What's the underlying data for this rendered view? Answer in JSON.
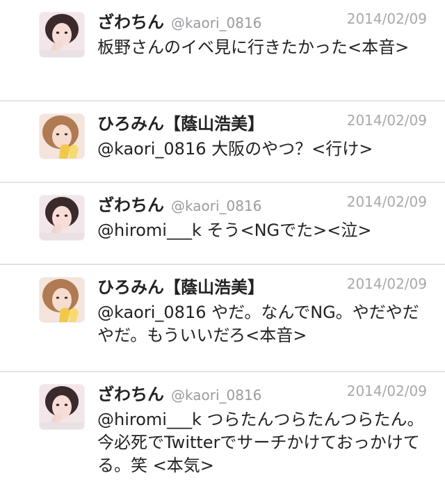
{
  "tweets": [
    {
      "name": "ざわちん",
      "handle": "@kaori_0816",
      "date": "2014/02/09",
      "text": "板野さんのイベ見に行きたかった<本音>",
      "avatar": "avatar-zawachin"
    },
    {
      "name": "ひろみん【蔭山浩美】",
      "handle": "",
      "date": "2014/02/09",
      "text": "@kaori_0816 大阪のやつ？<行け>",
      "avatar": "avatar-hiromin"
    },
    {
      "name": "ざわちん",
      "handle": "@kaori_0816",
      "date": "2014/02/09",
      "text": "@hiromi___k そう<NGでた><泣>",
      "avatar": "avatar-zawachin"
    },
    {
      "name": "ひろみん【蔭山浩美】",
      "handle": "",
      "date": "2014/02/09",
      "text": "@kaori_0816 やだ。なんでNG。やだやだやだ。もういいだろ<本音>",
      "avatar": "avatar-hiromin"
    },
    {
      "name": "ざわちん",
      "handle": "@kaori_0816",
      "date": "2014/02/09",
      "text": "@hiromi___k つらたんつらたんつらたん。今必死でTwitterでサーチかけておっかけてる。笑 <本気>",
      "avatar": "avatar-zawachin"
    }
  ],
  "colors": {
    "name": "#222222",
    "meta": "#a8a8ad",
    "divider": "#e3e3e6"
  }
}
